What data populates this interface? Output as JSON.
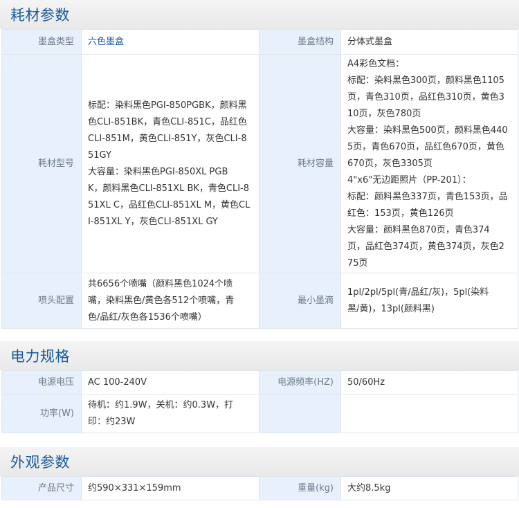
{
  "sections": {
    "consumables": {
      "title": "耗材参数",
      "rows": {
        "cartridge_type": {
          "label": "墨盒类型",
          "value": "六色墨盒"
        },
        "cartridge_structure": {
          "label": "墨盒结构",
          "value": "分体式墨盒"
        },
        "consumable_model": {
          "label": "耗材型号",
          "value": "标配：染料黑色PGI-850PGBK，颜料黑\n色CLI-851BK，青色CLI-851C，品红色\nCLI-851M，黄色CLI-851Y，灰色CLI-8\n51GY\n大容量：染料黑色PGI-850XL PGB\nK，颜料黑色CLI-851XL BK，青色CLI-8\n51XL C，品红色CLI-851XL M，黄色CL\nI-851XL Y，灰色CLI-851XL GY"
        },
        "consumable_capacity": {
          "label": "耗材容量",
          "value": "A4彩色文档：\n标配：染料黑色300页，颜料黑色1105\n页，青色310页，品红色310页，黄色3\n10页，灰色780页\n大容量：染料黑色500页，颜料黑色440\n5页，青色670页，品红色670页，黄色\n670页，灰色3305页\n4\"x6\"无边距照片（PP-201）：\n标配：颜料黑色337页，青色153页，品\n红色：153页，黄色126页\n大容量：颜料黑色870页，青色374\n页，品红色374页，黄色374页，灰色2\n75页"
        },
        "nozzle_config": {
          "label": "喷头配置",
          "value": "共6656个喷嘴（颜料黑色1024个喷\n嘴，染料黑色/黄色各512个喷嘴，青\n色/品红/灰色各1536个喷嘴）"
        },
        "min_droplet": {
          "label": "最小墨滴",
          "value": "1pl/2pl/5pl(青/品红/灰)，5pl(染料\n黑/黄)，13pl(颜料黑)"
        }
      }
    },
    "power": {
      "title": "电力规格",
      "rows": {
        "voltage": {
          "label": "电源电压",
          "value": "AC 100-240V"
        },
        "frequency": {
          "label": "电源频率(HZ)",
          "value": "50/60Hz"
        },
        "power_w": {
          "label": "功率(W)",
          "value": "待机：约1.9W，关机：约0.3W，打\n印：约23W"
        }
      }
    },
    "appearance": {
      "title": "外观参数",
      "rows": {
        "size": {
          "label": "产品尺寸",
          "value": "约590×331×159mm"
        },
        "weight": {
          "label": "重量(kg)",
          "value": "大约8.5kg"
        }
      }
    }
  },
  "colors": {
    "title_blue": "#1a5aa3",
    "label_bg": "#e8f1fb",
    "border": "#dfe5ec"
  }
}
